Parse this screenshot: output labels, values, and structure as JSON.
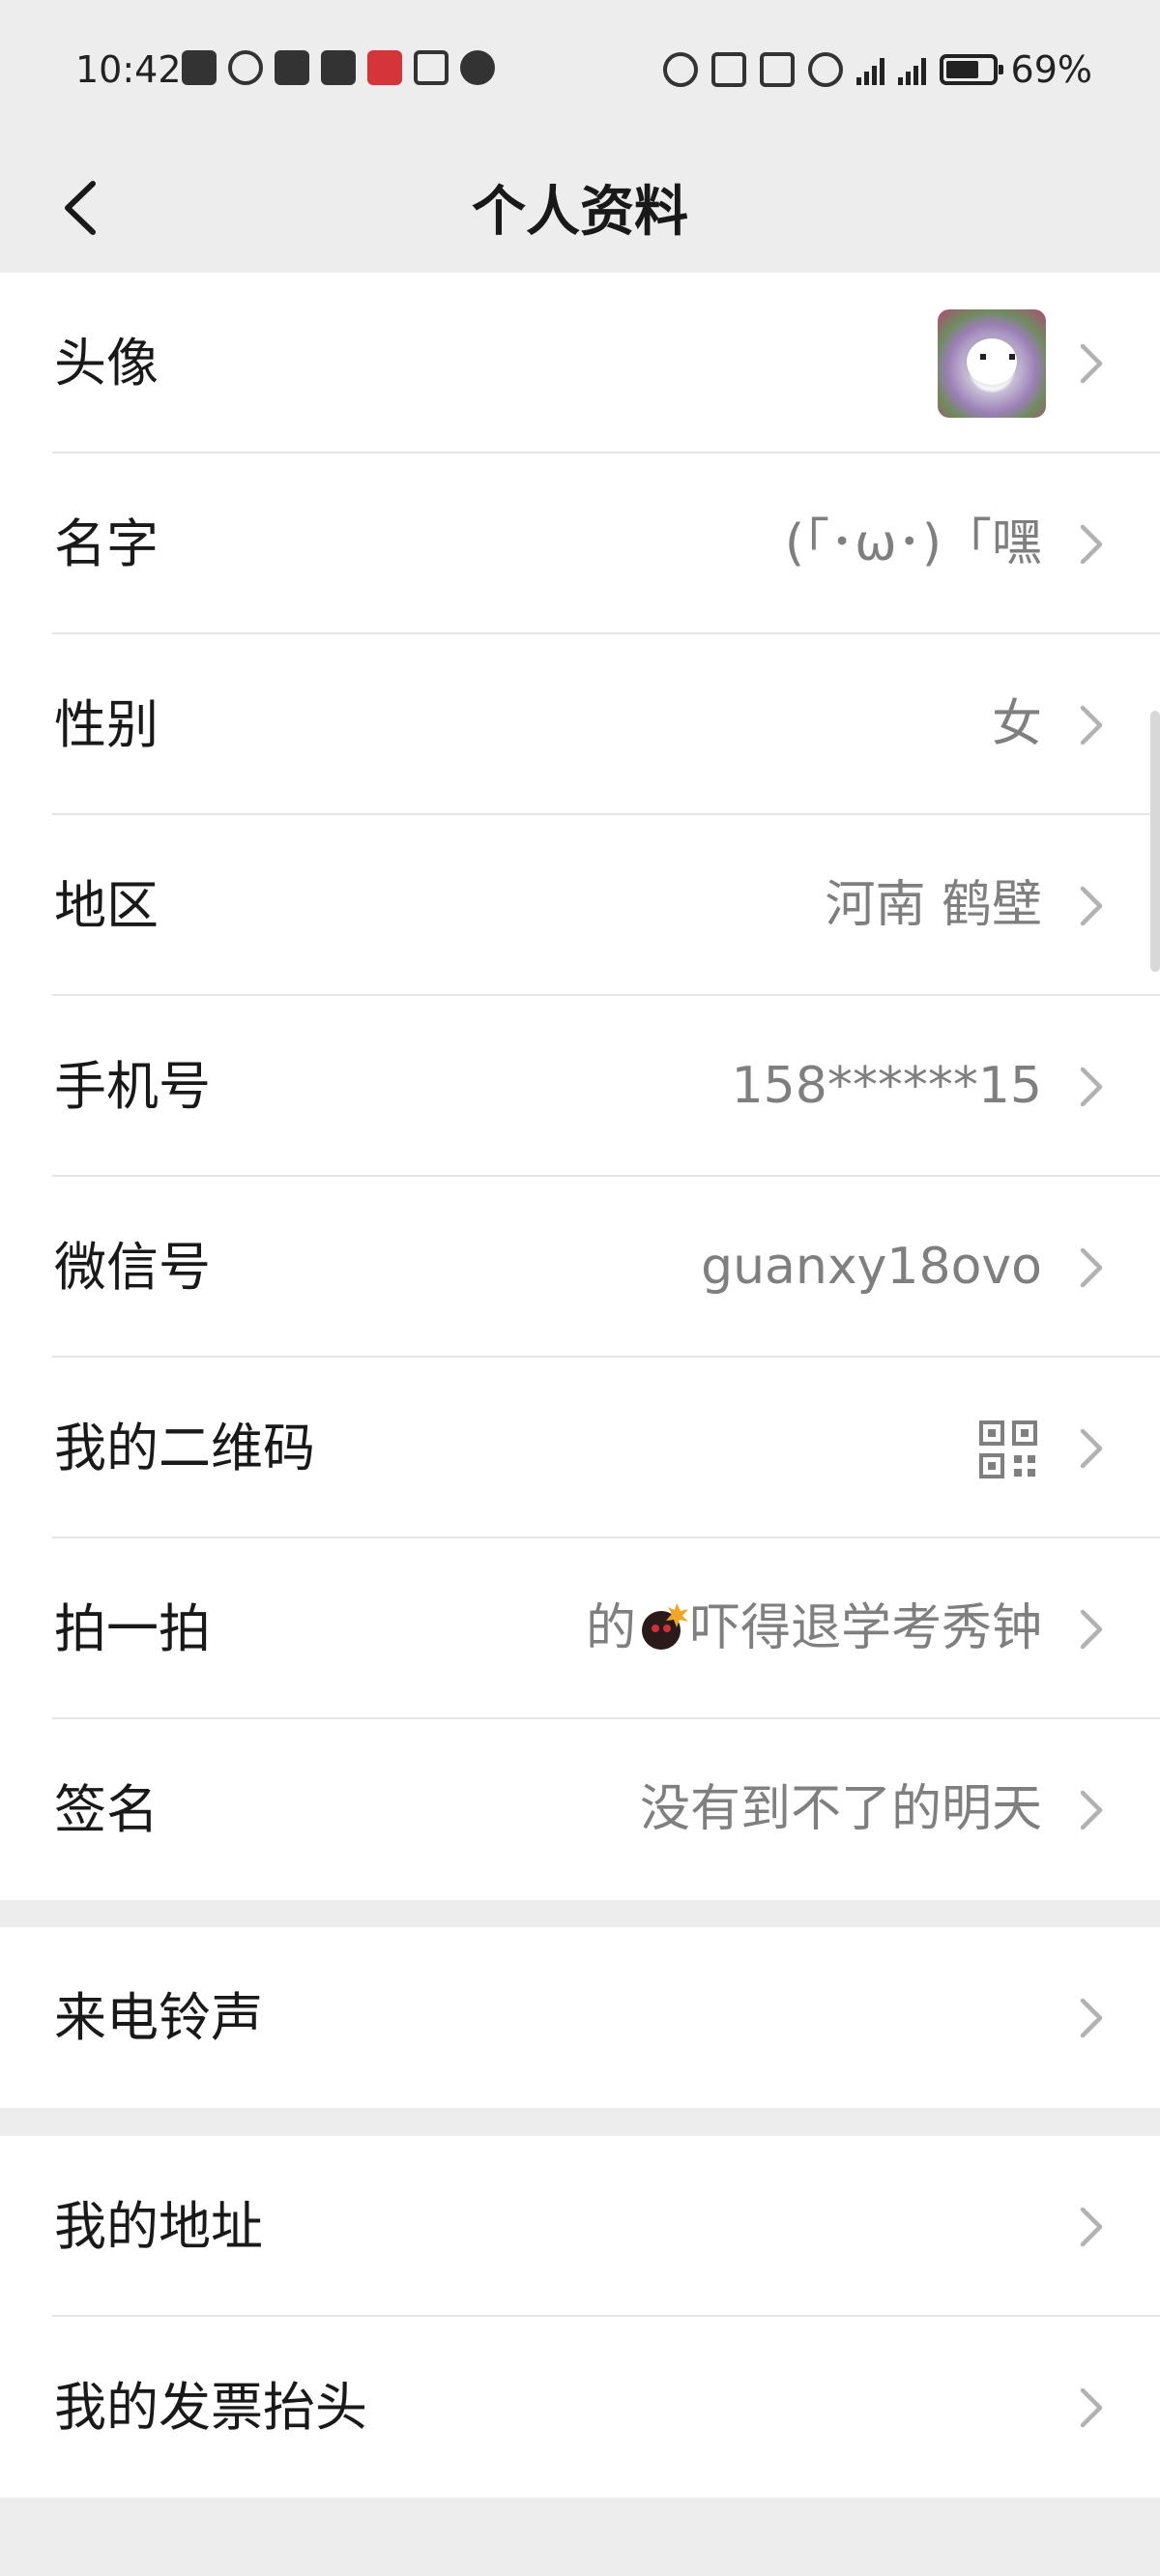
{
  "status_bar": {
    "time": "10:42",
    "battery_percent": "69%",
    "battery_level": 0.69,
    "network_1": "5G",
    "network_2": "5G"
  },
  "nav": {
    "title": "个人资料"
  },
  "profile_rows": [
    {
      "label": "头像",
      "value": ""
    },
    {
      "label": "名字",
      "value": "(「･ω･)「嘿"
    },
    {
      "label": "性别",
      "value": "女"
    },
    {
      "label": "地区",
      "value": "河南 鹤壁"
    },
    {
      "label": "手机号",
      "value": "158******15"
    },
    {
      "label": "微信号",
      "value": "guanxy18ovo"
    },
    {
      "label": "我的二维码",
      "value": ""
    },
    {
      "label": "拍一拍",
      "value_prefix": "的",
      "value_suffix": "吓得退学考秀钟"
    },
    {
      "label": "签名",
      "value": "没有到不了的明天"
    }
  ],
  "ringtone_row": {
    "label": "来电铃声"
  },
  "address_rows": [
    {
      "label": "我的地址"
    },
    {
      "label": "我的发票抬头"
    }
  ],
  "colors": {
    "background": "#ededed",
    "card": "#ffffff",
    "value_text": "#7f7f7f",
    "chevron": "#b2b2b2"
  }
}
